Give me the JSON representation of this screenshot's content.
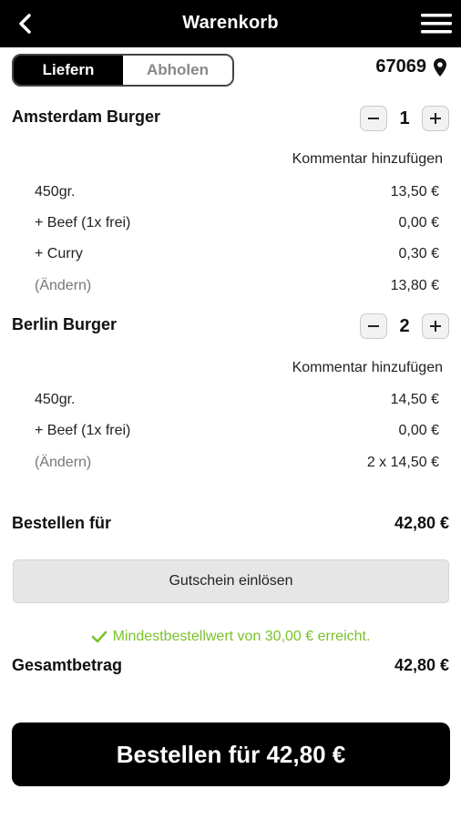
{
  "header": {
    "title": "Warenkorb",
    "back_icon": "chevron-left-icon",
    "menu_icon": "hamburger-menu-icon"
  },
  "delivery_toggle": {
    "options": [
      "Liefern",
      "Abholen"
    ],
    "selected": "Liefern"
  },
  "location": {
    "zip": "67069",
    "icon": "map-pin-icon"
  },
  "cart": {
    "items": [
      {
        "name": "Amsterdam Burger",
        "quantity": "1",
        "comment_label": "Kommentar hinzufügen",
        "lines": [
          {
            "label": "450gr.",
            "price": "13,50 €"
          },
          {
            "label": "+ Beef (1x frei)",
            "price": "0,00 €"
          },
          {
            "label": "+ Curry",
            "price": "0,30 €"
          },
          {
            "label": "(Ändern)",
            "price": "13,80 €"
          }
        ]
      },
      {
        "name": "Berlin Burger",
        "quantity": "2",
        "comment_label": "Kommentar hinzufügen",
        "lines": [
          {
            "label": "450gr.",
            "price": "14,50 €"
          },
          {
            "label": "+ Beef (1x frei)",
            "price": "0,00 €"
          },
          {
            "label": "(Ändern)",
            "price": "2 x 14,50 €"
          }
        ]
      }
    ]
  },
  "summary": {
    "order_for_label": "Bestellen für",
    "order_for_value": "42,80 €",
    "voucher_label": "Gutschein einlösen",
    "min_order_message": "Mindestbestellwert von 30,00 € erreicht.",
    "total_label": "Gesamtbetrag",
    "total_value": "42,80 €"
  },
  "order_button": {
    "label": "Bestellen für 42,80 €"
  },
  "colors": {
    "accent_green": "#7ac22a",
    "primary": "#000000"
  }
}
